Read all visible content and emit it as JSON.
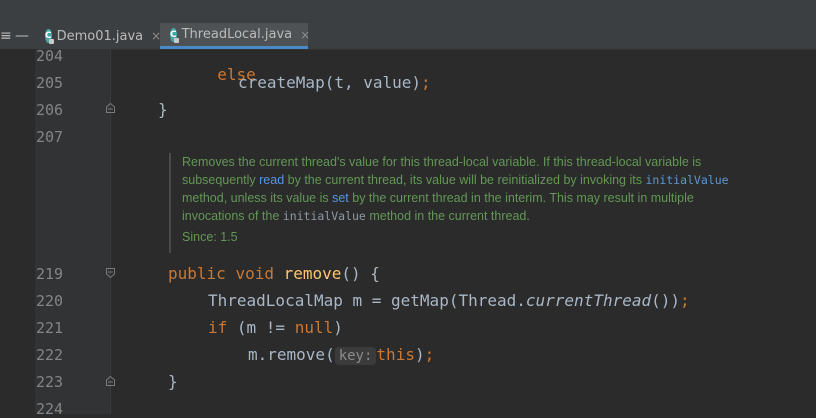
{
  "tabs": [
    {
      "label": "Demo01.java",
      "active": false
    },
    {
      "label": "ThreadLocal.java",
      "active": true
    }
  ],
  "tab_close_glyph": "×",
  "left_buttons": {
    "settings": "≡",
    "minimize": "—"
  },
  "code_top": [
    {
      "line": "204",
      "kw": "else"
    },
    {
      "line": "205",
      "text": "createMap(t, value)",
      "semi": ";"
    },
    {
      "line": "206",
      "text": "}"
    },
    {
      "line": "207"
    }
  ],
  "doc": {
    "l1": "Removes the current thread's value for this thread-local variable. If this thread-local variable is",
    "l2a": "subsequently ",
    "l2b": "read",
    "l2c": " by the current thread, its value will be reinitialized by invoking its ",
    "l2d": "initialValue",
    "l3a": "method, unless its value is ",
    "l3b": "set",
    "l3c": " by the current thread in the interim. This may result in multiple",
    "l4a": "invocations of the ",
    "l4b": "initialValue",
    "l4c": " method in the current thread.",
    "since": "Since: 1.5"
  },
  "code_bottom": {
    "l219": {
      "line": "219",
      "kw1": "public",
      "kw2": "void",
      "fn": "remove",
      "rest": "() {"
    },
    "l220": {
      "line": "220",
      "a": "ThreadLocalMap m = getMap(Thread.",
      "b": "currentThread",
      "c": "())",
      "semi": ";"
    },
    "l221": {
      "line": "221",
      "kw": "if",
      "a": " (m != ",
      "kw2": "null",
      "b": ")"
    },
    "l222": {
      "line": "222",
      "a": "m.remove(",
      "hint": "key:",
      "kw": "this",
      "b": ")",
      "semi": ";"
    },
    "l223": {
      "line": "223",
      "text": "}"
    },
    "l224": {
      "line": "224"
    }
  }
}
